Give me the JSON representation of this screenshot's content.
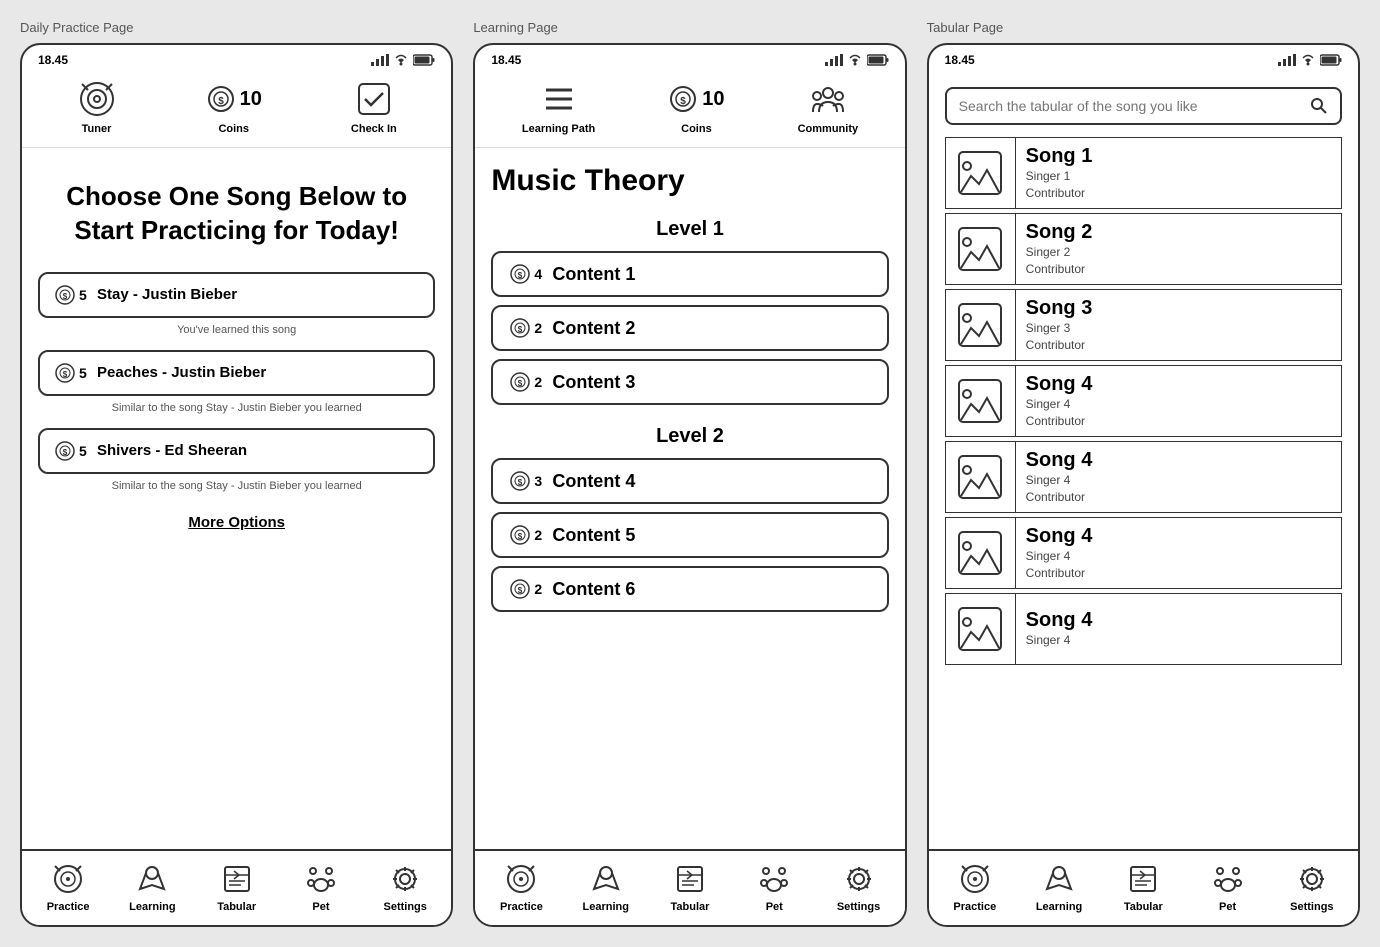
{
  "pages": [
    {
      "label": "Daily Practice Page",
      "statusBar": {
        "time": "18.45",
        "icons": [
          "signal",
          "wifi",
          "battery"
        ]
      },
      "topNav": [
        {
          "id": "tuner",
          "label": "Tuner"
        },
        {
          "id": "coins",
          "label": "Coins",
          "value": "10"
        },
        {
          "id": "checkin",
          "label": "Check In"
        }
      ],
      "mainTitle": "Choose One Song Below to Start Practicing for Today!",
      "songs": [
        {
          "coins": "5",
          "name": "Stay - Justin Bieber",
          "subtitle": "You've learned this song"
        },
        {
          "coins": "5",
          "name": "Peaches - Justin Bieber",
          "subtitle": "Similar to the song Stay - Justin Bieber you learned"
        },
        {
          "coins": "5",
          "name": "Shivers - Ed Sheeran",
          "subtitle": "Similar to the song Stay - Justin Bieber you learned"
        }
      ],
      "moreOptions": "More Options",
      "bottomNav": [
        {
          "id": "practice",
          "label": "Practice"
        },
        {
          "id": "learning",
          "label": "Learning"
        },
        {
          "id": "tabular",
          "label": "Tabular"
        },
        {
          "id": "pet",
          "label": "Pet"
        },
        {
          "id": "settings",
          "label": "Settings"
        }
      ]
    },
    {
      "label": "Learning Page",
      "statusBar": {
        "time": "18.45",
        "icons": [
          "signal",
          "wifi",
          "battery"
        ]
      },
      "topNav": [
        {
          "id": "learning-path",
          "label": "Learning Path"
        },
        {
          "id": "coins",
          "label": "Coins",
          "value": "10"
        },
        {
          "id": "community",
          "label": "Community"
        }
      ],
      "subject": "Music Theory",
      "levels": [
        {
          "label": "Level 1",
          "contents": [
            {
              "coins": "4",
              "name": "Content 1"
            },
            {
              "coins": "2",
              "name": "Content 2"
            },
            {
              "coins": "2",
              "name": "Content 3"
            }
          ]
        },
        {
          "label": "Level 2",
          "contents": [
            {
              "coins": "3",
              "name": "Content 4"
            },
            {
              "coins": "2",
              "name": "Content 5"
            },
            {
              "coins": "2",
              "name": "Content 6"
            }
          ]
        }
      ],
      "bottomNav": [
        {
          "id": "practice",
          "label": "Practice"
        },
        {
          "id": "learning",
          "label": "Learning"
        },
        {
          "id": "tabular",
          "label": "Tabular"
        },
        {
          "id": "pet",
          "label": "Pet"
        },
        {
          "id": "settings",
          "label": "Settings"
        }
      ]
    },
    {
      "label": "Tabular Page",
      "statusBar": {
        "time": "18.45",
        "icons": [
          "signal",
          "wifi",
          "battery"
        ]
      },
      "searchPlaceholder": "Search the tabular of the song you like",
      "songs": [
        {
          "title": "Song 1",
          "singer": "Singer 1",
          "contributor": "Contributor"
        },
        {
          "title": "Song 2",
          "singer": "Singer 2",
          "contributor": "Contributor"
        },
        {
          "title": "Song 3",
          "singer": "Singer 3",
          "contributor": "Contributor"
        },
        {
          "title": "Song 4",
          "singer": "Singer 4",
          "contributor": "Contributor"
        },
        {
          "title": "Song 4",
          "singer": "Singer 4",
          "contributor": "Contributor"
        },
        {
          "title": "Song 4",
          "singer": "Singer 4",
          "contributor": "Contributor"
        },
        {
          "title": "Song 4",
          "singer": "Singer 4",
          "contributor": ""
        }
      ],
      "bottomNav": [
        {
          "id": "practice",
          "label": "Practice"
        },
        {
          "id": "learning",
          "label": "Learning"
        },
        {
          "id": "tabular",
          "label": "Tabular"
        },
        {
          "id": "pet",
          "label": "Pet"
        },
        {
          "id": "settings",
          "label": "Settings"
        }
      ]
    }
  ]
}
